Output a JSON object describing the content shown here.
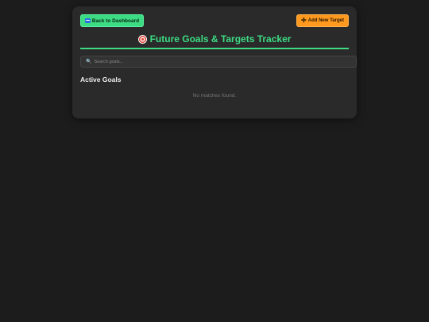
{
  "header": {
    "back_label": "Back to Dashboard",
    "add_label": "Add New Target",
    "title": "Future Goals & Targets Tracker"
  },
  "search": {
    "placeholder": "Search goals..."
  },
  "goals": {
    "section_title": "Active Goals",
    "empty_message": "No matches found."
  },
  "colors": {
    "background": "#1c1c1c",
    "card": "#2a2a2a",
    "accent_green": "#3ddc84",
    "accent_orange": "#ff9a1f"
  },
  "icons": {
    "back": "back-arrow-icon",
    "add": "plus-icon",
    "title": "target-icon",
    "search": "search-icon"
  }
}
